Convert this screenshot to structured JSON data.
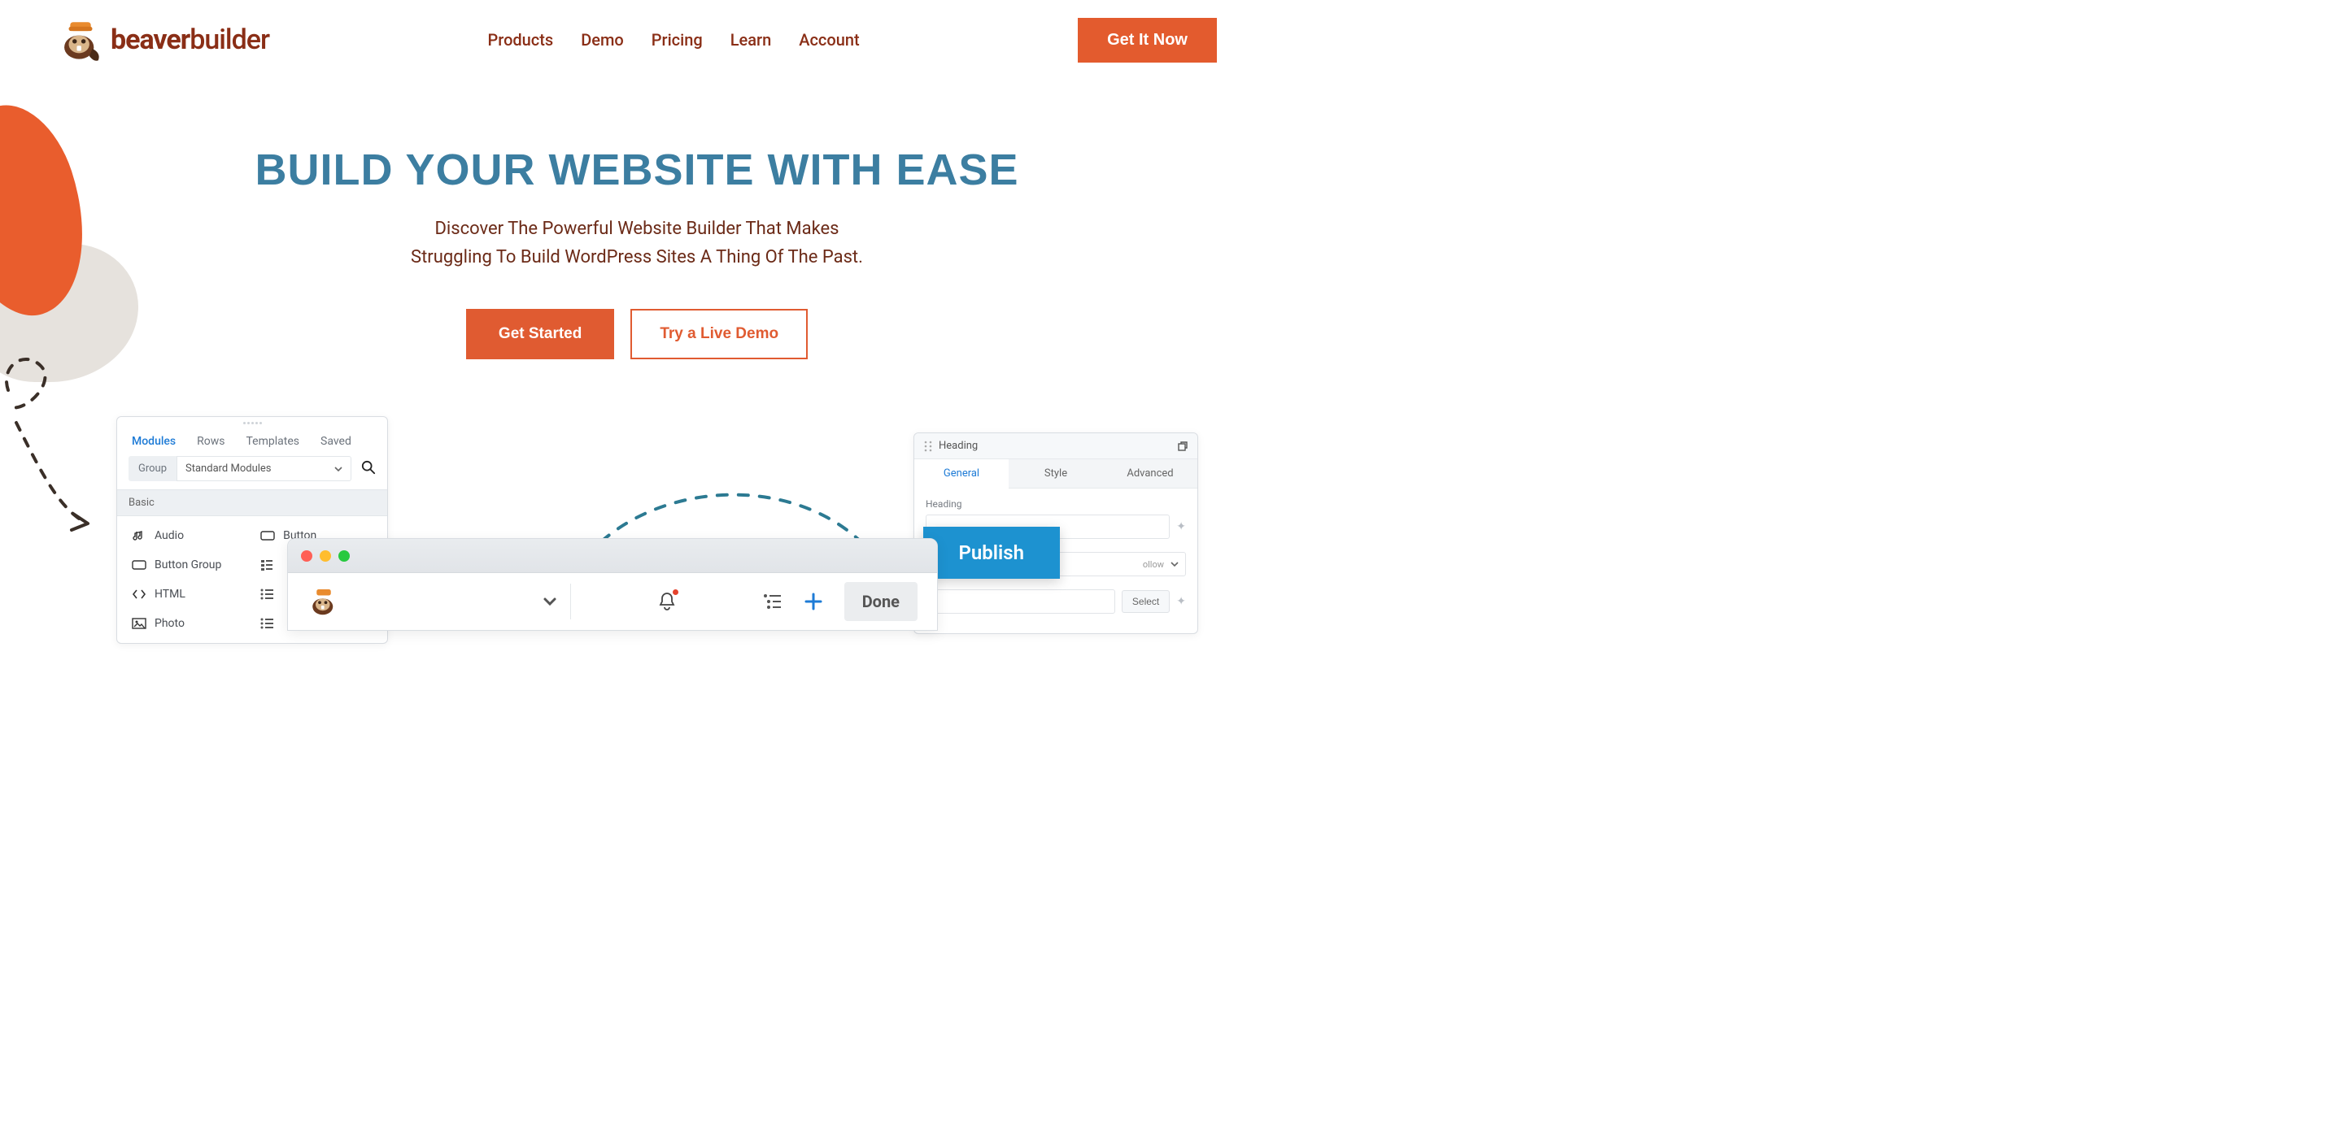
{
  "brand": {
    "name_first": "beaver",
    "name_second": "builder"
  },
  "nav": {
    "products": "Products",
    "demo": "Demo",
    "pricing": "Pricing",
    "learn": "Learn",
    "account": "Account"
  },
  "cta": {
    "get_it_now": "Get It Now"
  },
  "hero": {
    "headline": "BUILD YOUR WEBSITE WITH EASE",
    "sub1": "Discover The Powerful Website Builder That Makes",
    "sub2": "Struggling To Build WordPress Sites A Thing Of The Past.",
    "get_started": "Get Started",
    "try_demo": "Try a Live Demo"
  },
  "modules_panel": {
    "tabs": {
      "modules": "Modules",
      "rows": "Rows",
      "templates": "Templates",
      "saved": "Saved"
    },
    "group_label": "Group",
    "group_value": "Standard Modules",
    "category": "Basic",
    "items": {
      "audio": "Audio",
      "button": "Button",
      "button_group": "Button Group",
      "html": "HTML",
      "photo": "Photo"
    }
  },
  "settings_panel": {
    "title": "Heading",
    "tabs": {
      "general": "General",
      "style": "Style",
      "advanced": "Advanced"
    },
    "field_label": "Heading",
    "select_btn": "Select",
    "follow_text": "ollow"
  },
  "publish": {
    "label": "Publish"
  },
  "window": {
    "done": "Done"
  }
}
